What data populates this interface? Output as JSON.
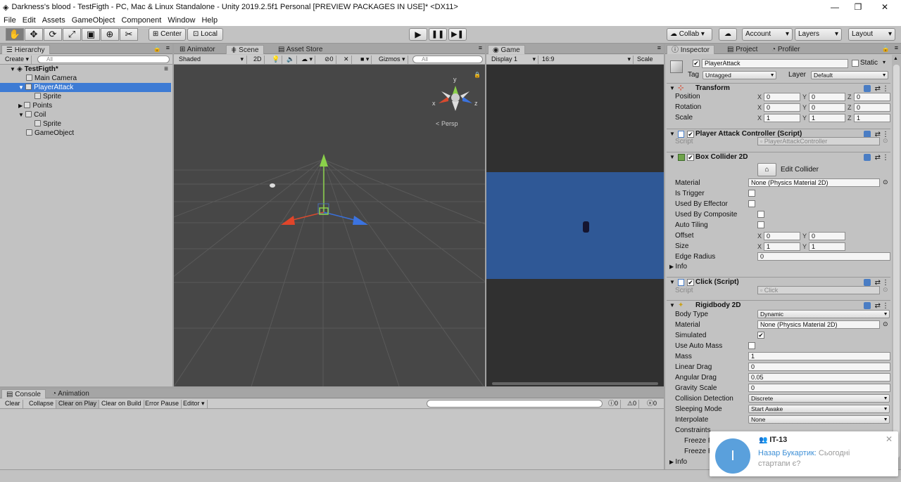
{
  "window": {
    "title": "Darkness's blood - TestFigth - PC, Mac & Linux Standalone - Unity 2019.2.5f1 Personal [PREVIEW PACKAGES IN USE]* <DX11>",
    "minimize": "—",
    "maximize": "❐",
    "close": "✕"
  },
  "menu": [
    "File",
    "Edit",
    "Assets",
    "GameObject",
    "Component",
    "Window",
    "Help"
  ],
  "toolbar": {
    "center": "Center",
    "local": "Local",
    "collab": "Collab",
    "account": "Account",
    "layers": "Layers",
    "layout": "Layout"
  },
  "hierarchy": {
    "tab": "Hierarchy",
    "create": "Create",
    "search_placeholder": "All",
    "scene": "TestFigth*",
    "items": [
      {
        "label": "Main Camera"
      },
      {
        "label": "PlayerAttack"
      },
      {
        "label": "Sprite"
      },
      {
        "label": "Points"
      },
      {
        "label": "Coil"
      },
      {
        "label": "Sprite"
      },
      {
        "label": "GameObject"
      }
    ]
  },
  "scene": {
    "tabs": [
      "Animator",
      "Scene",
      "Asset Store"
    ],
    "shading": "Shaded",
    "mode2d": "2D",
    "hidden_count": "0",
    "gizmos": "Gizmos",
    "search_placeholder": "All",
    "persp": "Persp",
    "axis_y": "y",
    "axis_x": "x",
    "axis_z": "z"
  },
  "game": {
    "tab": "Game",
    "display": "Display 1",
    "aspect": "16:9",
    "scale": "Scale"
  },
  "console": {
    "tabs": [
      "Console",
      "Animation"
    ],
    "buttons": [
      "Clear",
      "Collapse",
      "Clear on Play",
      "Clear on Build",
      "Error Pause",
      "Editor"
    ],
    "counts": [
      "0",
      "0",
      "0"
    ]
  },
  "inspector": {
    "tabs": [
      "Inspector",
      "Project",
      "Profiler"
    ],
    "object_name": "PlayerAttack",
    "static": "Static",
    "tag_label": "Tag",
    "tag": "Untagged",
    "layer_label": "Layer",
    "layer": "Default",
    "transform": {
      "title": "Transform",
      "position": "Position",
      "rotation": "Rotation",
      "scale": "Scale",
      "pos": [
        "0",
        "0",
        "0"
      ],
      "rot": [
        "0",
        "0",
        "0"
      ],
      "scl": [
        "1",
        "1",
        "1"
      ]
    },
    "pac": {
      "title": "Player Attack Controller (Script)",
      "script_label": "Script",
      "script": "PlayerAttackController"
    },
    "box": {
      "title": "Box Collider 2D",
      "edit": "Edit Collider",
      "material_label": "Material",
      "material": "None (Physics Material 2D)",
      "is_trigger": "Is Trigger",
      "used_by_effector": "Used By Effector",
      "used_by_composite": "Used By Composite",
      "auto_tiling": "Auto Tiling",
      "offset": "Offset",
      "offset_vals": [
        "0",
        "0"
      ],
      "size": "Size",
      "size_vals": [
        "1",
        "1"
      ],
      "edge_radius": "Edge Radius",
      "edge_val": "0",
      "info": "Info"
    },
    "click": {
      "title": "Click (Script)",
      "script_label": "Script",
      "script": "Click"
    },
    "rb": {
      "title": "Rigidbody 2D",
      "body_type_label": "Body Type",
      "body_type": "Dynamic",
      "material_label": "Material",
      "material": "None (Physics Material 2D)",
      "simulated": "Simulated",
      "use_auto_mass": "Use Auto Mass",
      "mass_label": "Mass",
      "mass": "1",
      "linear_drag_label": "Linear Drag",
      "linear_drag": "0",
      "angular_drag_label": "Angular Drag",
      "angular_drag": "0.05",
      "gravity_label": "Gravity Scale",
      "gravity": "0",
      "collision_label": "Collision Detection",
      "collision": "Discrete",
      "sleeping_label": "Sleeping Mode",
      "sleeping": "Start Awake",
      "interpolate_label": "Interpolate",
      "interpolate": "None",
      "constraints": "Constraints",
      "freeze1": "Freeze P",
      "freeze2": "Freeze R",
      "info": "Info"
    }
  },
  "notification": {
    "group": "IT-13",
    "avatar": "I",
    "sender": "Назар Букартик:",
    "message": "Сьогодні стартапи є?"
  },
  "colors": {
    "selection": "#3d7bd4",
    "scene_bg": "#474747",
    "game_blue": "#2f5896",
    "notif_avatar": "#5aa0dc"
  }
}
